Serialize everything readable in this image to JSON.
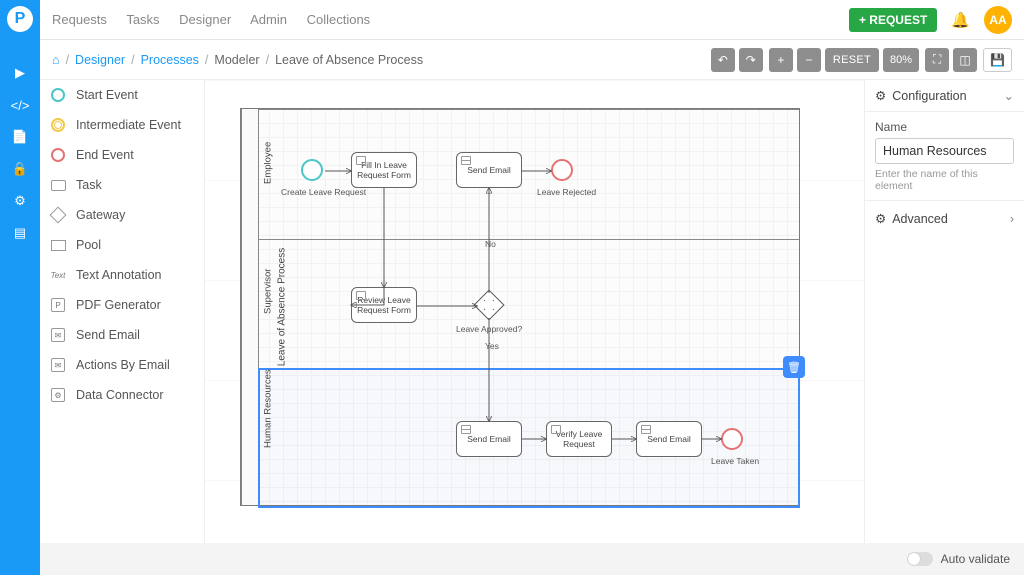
{
  "topnav": {
    "items": [
      "Requests",
      "Tasks",
      "Designer",
      "Admin",
      "Collections"
    ],
    "request_btn": "+ REQUEST",
    "avatar": "AA"
  },
  "breadcrumbs": {
    "items": [
      "Designer",
      "Processes",
      "Modeler",
      "Leave of Absence Process"
    ]
  },
  "toolbar": {
    "reset": "RESET",
    "zoom": "80%"
  },
  "palette": {
    "items": [
      {
        "label": "Start Event",
        "icon": "start"
      },
      {
        "label": "Intermediate Event",
        "icon": "inter"
      },
      {
        "label": "End Event",
        "icon": "end"
      },
      {
        "label": "Task",
        "icon": "task"
      },
      {
        "label": "Gateway",
        "icon": "gate"
      },
      {
        "label": "Pool",
        "icon": "pool"
      },
      {
        "label": "Text Annotation",
        "icon": "text"
      },
      {
        "label": "PDF Generator",
        "icon": "blk"
      },
      {
        "label": "Send Email",
        "icon": "blk"
      },
      {
        "label": "Actions By Email",
        "icon": "blk"
      },
      {
        "label": "Data Connector",
        "icon": "blk"
      }
    ]
  },
  "process": {
    "pool_name": "Leave of Absence Process",
    "lanes": [
      "Employee",
      "Supervisor",
      "Human Resources"
    ],
    "selected_lane": 2,
    "captions": {
      "create": "Create Leave Request",
      "rejected": "Leave Rejected",
      "approved_q": "Leave Approved?",
      "no": "No",
      "yes": "Yes",
      "taken": "Leave Taken"
    },
    "tasks": {
      "fill": "Fill In Leave Request Form",
      "send1": "Send Email",
      "review": "Review Leave Request Form",
      "send2": "Send Email",
      "verify": "Verify Leave Request",
      "send3": "Send Email"
    }
  },
  "config": {
    "title": "Configuration",
    "name_label": "Name",
    "name_value": "Human Resources",
    "name_hint": "Enter the name of this element",
    "advanced": "Advanced"
  },
  "footer": {
    "auto_validate": "Auto validate"
  }
}
